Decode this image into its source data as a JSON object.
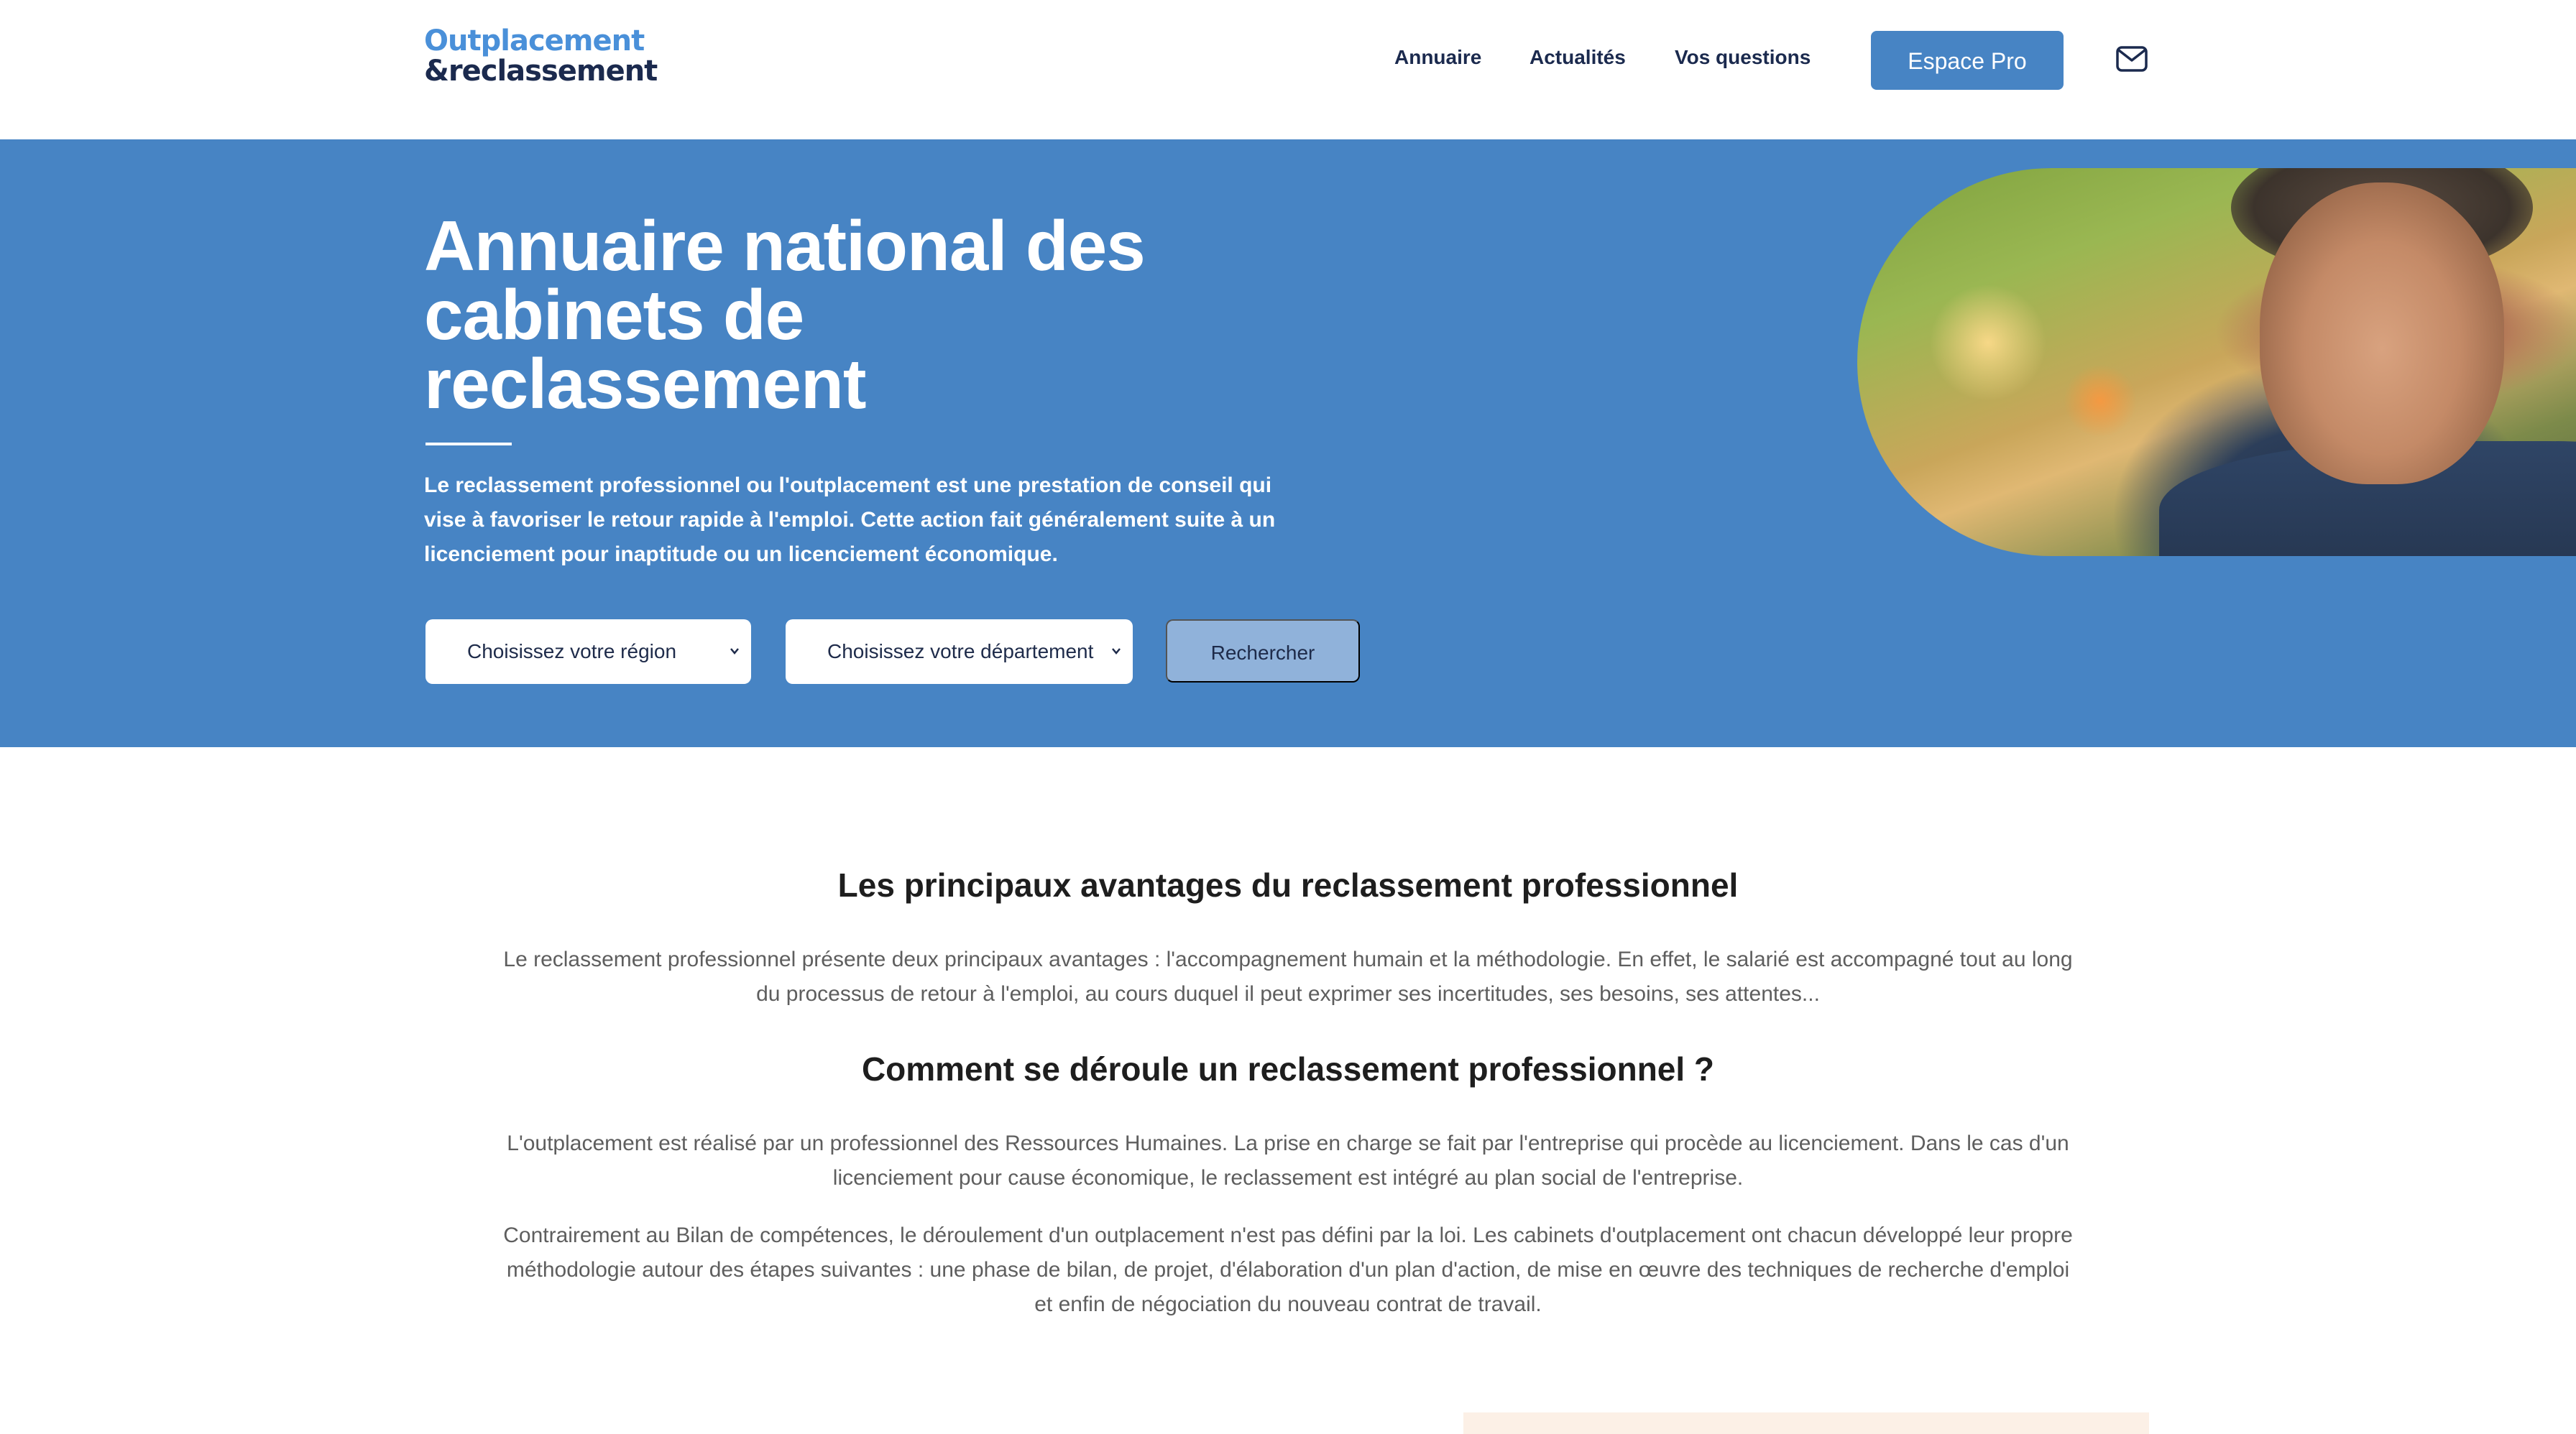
{
  "header": {
    "logo": {
      "line1": "Outplacement",
      "line2": "&reclassement"
    },
    "nav": [
      {
        "label": "Annuaire"
      },
      {
        "label": "Actualités"
      },
      {
        "label": "Vos questions"
      }
    ],
    "cta_label": "Espace Pro",
    "contact_icon": "mail-icon"
  },
  "hero": {
    "title": "Annuaire national des cabinets de reclassement",
    "intro": "Le reclassement professionnel ou l'outplacement est une prestation de conseil qui vise à favoriser le retour rapide à l'emploi. Cette action fait généralement suite à un licenciement pour inaptitude ou un licenciement économique.",
    "region_select": {
      "selected": "Choisissez votre région"
    },
    "department_select": {
      "selected": "Choisissez votre département"
    },
    "search_label": "Rechercher"
  },
  "content": {
    "section1": {
      "title": "Les principaux avantages du reclassement professionnel",
      "paragraph": "Le reclassement professionnel présente deux principaux avantages : l'accompagnement humain et la méthodologie. En effet, le salarié est accompagné tout au long du processus de retour à l'emploi, au cours duquel il peut exprimer ses incertitudes, ses besoins, ses attentes..."
    },
    "section2": {
      "title": "Comment se déroule un reclassement professionnel ?",
      "paragraph1": "L'outplacement est réalisé par un professionnel des Ressources Humaines. La prise en charge se fait par l'entreprise qui procède au licenciement. Dans le cas d'un licenciement pour cause économique, le reclassement est intégré au plan social de l'entreprise.",
      "paragraph2": "Contrairement au Bilan de compétences, le déroulement d'un outplacement n'est pas défini par la loi. Les cabinets d'outplacement ont chacun développé leur propre méthodologie autour des étapes suivantes : une phase de bilan, de projet, d'élaboration d'un plan d'action, de mise en œuvre des techniques de recherche d'emploi et enfin de négociation du nouveau contrat de travail."
    }
  },
  "colors": {
    "brand_blue": "#4784c4",
    "navy": "#1b2a4e",
    "button_muted": "#90b2da",
    "card_peach": "#fcf0e6"
  }
}
